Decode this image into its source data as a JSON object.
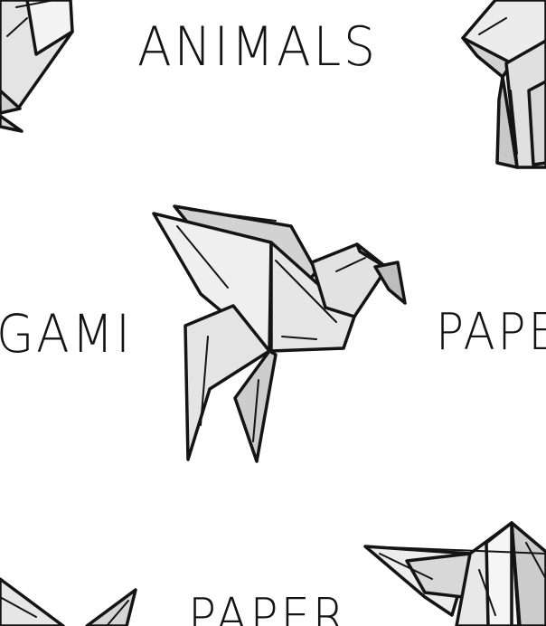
{
  "words": {
    "animals": "ANIMALS",
    "origami_fragment": "GAMI",
    "paper_right_fragment": "PAPE",
    "paper_bottom": "PAPER"
  },
  "figures": [
    {
      "name": "origami-bird",
      "kind": "crane"
    },
    {
      "name": "origami-boat-partial",
      "kind": "boat"
    },
    {
      "name": "origami-animal-partial-top-left",
      "kind": "animal"
    },
    {
      "name": "origami-animal-partial-top-right",
      "kind": "animal"
    },
    {
      "name": "origami-bird-partial-bottom-left",
      "kind": "bird"
    }
  ],
  "colors": {
    "background": "#ffffff",
    "ink": "#141414",
    "paper_light": "#f0f0f0",
    "paper_mid": "#d6d6d6",
    "paper_dark": "#bdbdbd"
  }
}
